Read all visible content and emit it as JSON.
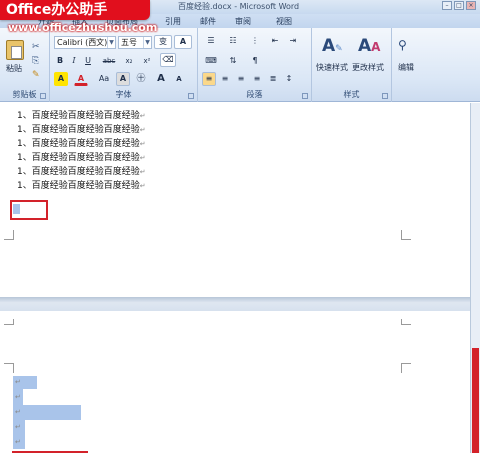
{
  "window": {
    "title": "百度经验.docx - Microsoft Word",
    "minimize": "–",
    "restore": "□",
    "close": "×"
  },
  "watermark": {
    "logo_text": "Office办公助手",
    "url": "www.officezhushou.com"
  },
  "tabs": [
    "开始",
    "插入",
    "页面布局",
    "引用",
    "邮件",
    "审阅",
    "视图"
  ],
  "ribbon": {
    "clipboard": {
      "paste_label": "粘贴",
      "group_label": "剪贴板"
    },
    "font": {
      "font_name": "Calibri (西文)",
      "font_size": "五号",
      "group_label": "字体",
      "buttons": [
        "B",
        "I",
        "U",
        "abc",
        "x₂",
        "x²",
        "A",
        "A",
        "Aa",
        "A",
        "A",
        "A"
      ]
    },
    "paragraph": {
      "group_label": "段落"
    },
    "styles": {
      "quick_styles_label": "快速样式",
      "change_styles_label": "更改样式",
      "group_label": "样式"
    },
    "editing": {
      "label": "编辑"
    }
  },
  "document": {
    "lines": [
      "1、百度经验百度经验百度经验",
      "1、百度经验百度经验百度经验",
      "1、百度经验百度经验百度经验",
      "1、百度经验百度经验百度经验",
      "1、百度经验百度经验百度经验",
      "1、百度经验百度经验百度经验"
    ],
    "return_mark": "↵"
  },
  "colors": {
    "accent": "#d3222a",
    "ribbon": "#dbe7f6",
    "selection": "#a9c4ea"
  }
}
